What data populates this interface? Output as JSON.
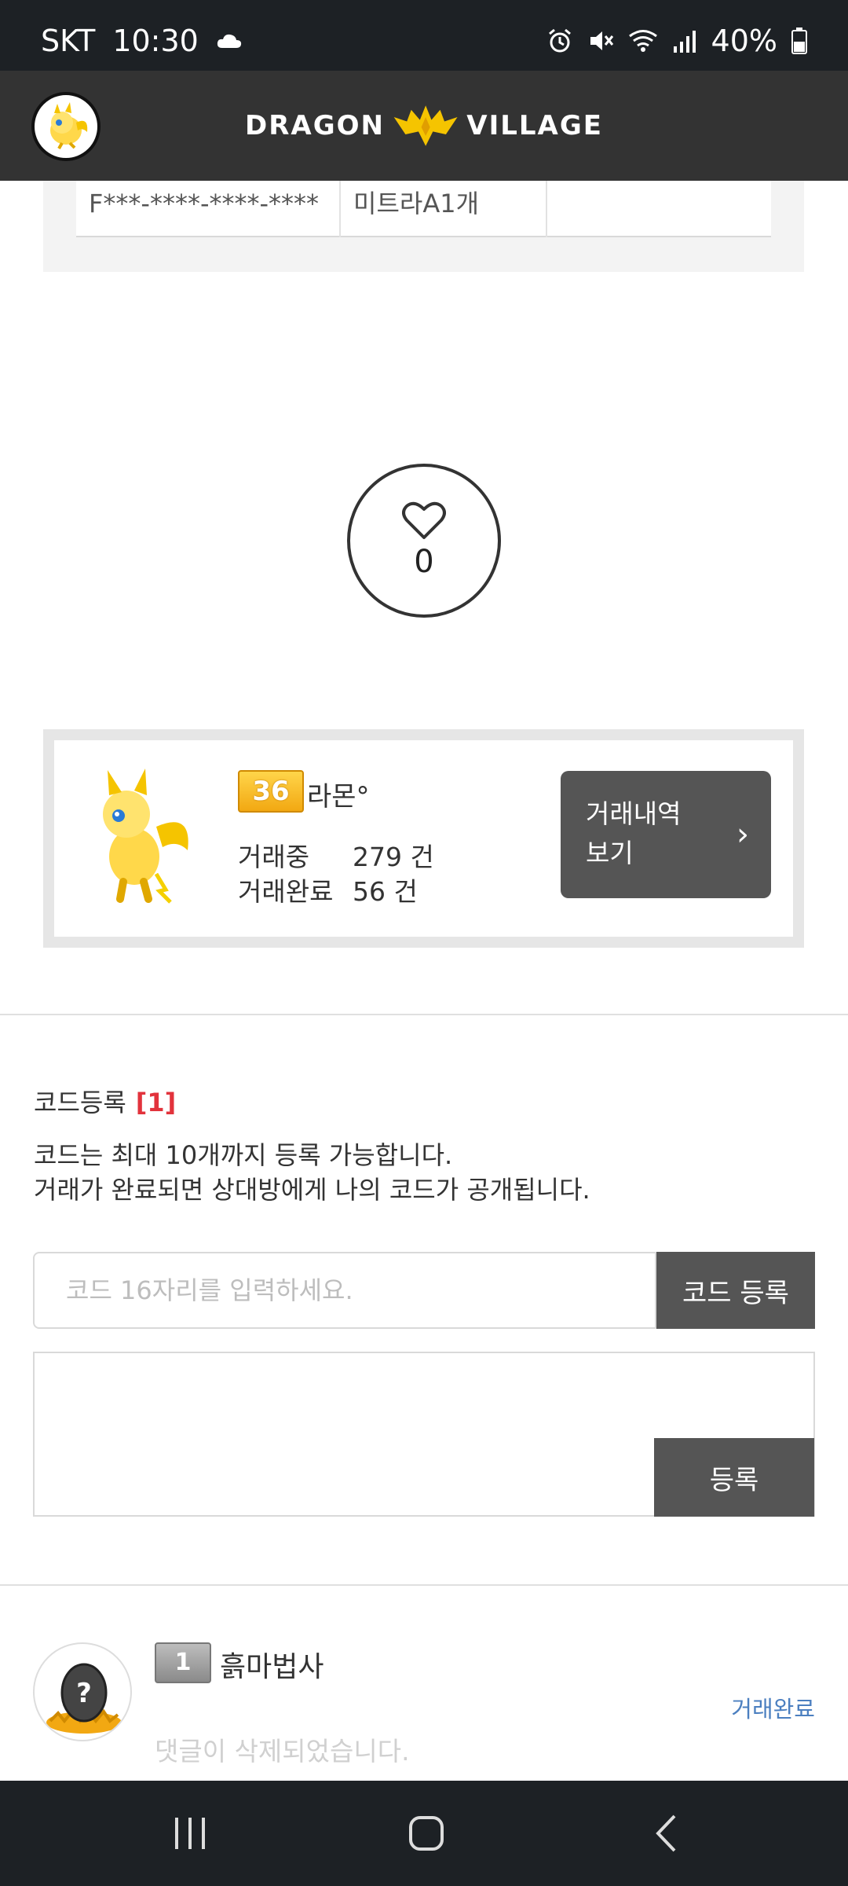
{
  "status_bar": {
    "carrier": "SKT",
    "time": "10:30",
    "battery": "40%"
  },
  "header": {
    "logo_text_left": "DRAGON",
    "logo_text_right": "VILLAGE"
  },
  "code_table": {
    "row": [
      "F***-****-****-****",
      "미트라A1개",
      ""
    ]
  },
  "like": {
    "count": "0"
  },
  "profile": {
    "level": "36",
    "nickname": "라몬°",
    "trading_label": "거래중",
    "trading_count": "279 건",
    "completed_label": "거래완료",
    "completed_count": "56 건",
    "history_button_line1": "거래내역",
    "history_button_line2": "보기"
  },
  "code_registration": {
    "title": "코드등록",
    "count": "[1]",
    "desc_line1": "코드는 최대 10개까지 등록 가능합니다.",
    "desc_line2": "거래가 완료되면 상대방에게 나의 코드가 공개됩니다.",
    "input_placeholder": "코드 16자리를 입력하세요.",
    "register_button": "코드 등록",
    "submit_button": "등록"
  },
  "comment": {
    "level": "1",
    "user": "흙마법사",
    "status": "거래완료",
    "text": "댓글이 삭제되었습니다."
  },
  "colors": {
    "header_bg": "#333333",
    "button_bg": "#555555",
    "accent_red": "#e2333c",
    "status_blue": "#4b7fc0"
  }
}
